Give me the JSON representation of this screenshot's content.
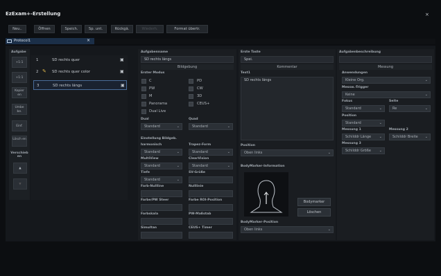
{
  "window": {
    "title": "EzExam+-Erstellung",
    "close": "×"
  },
  "toolbar": [
    "Neu..",
    "Öffnen",
    "Speich.",
    "Sp. unt.",
    "Rückgä.",
    "Wiederh.",
    "Format übertr."
  ],
  "tab": {
    "label": "Protocol1",
    "close": "×"
  },
  "left": {
    "aufgabe": "Aufgabe",
    "btn1": "+1:1",
    "btn2": "+1:1",
    "kopieren": "Kopier en",
    "umbenennen": "Umbe\nbe.",
    "einf": "Einf.",
    "loeschen": "Lösch en",
    "verschieben": "Verschieb en",
    "up": "▲",
    "down": "▼"
  },
  "tasks": [
    {
      "num": "1",
      "label": "SD rechts quer"
    },
    {
      "num": "2",
      "label": "SD rechts quer color"
    },
    {
      "num": "3",
      "label": "SD rechts längs"
    }
  ],
  "aufgabe": {
    "name_label": "Aufgabenname",
    "name_value": "SD rechts längs",
    "bildgebung": "Bildgebung",
    "erster_modus": "Erster Modus",
    "modes_left": [
      "C",
      "PW",
      "M",
      "Panorama",
      "Dual Live"
    ],
    "modes_right": [
      "PD",
      "CW",
      "3D",
      "CEUS+"
    ],
    "dual": "Dual",
    "dual_val": "Standard",
    "quad": "Quad",
    "quad_val": "Standard",
    "einst": "Einstellung Bildgeb.",
    "harmonisch": "harmonisch",
    "harm_val": "Standard",
    "trapez": "Trapez-Form",
    "trapez_val": "Standard",
    "multiview": "MultiView",
    "mv_val": "Standard",
    "clear": "ClearVision",
    "cv_val": "Standard",
    "tiefe": "Tiefe",
    "tiefe_val": "Standard",
    "sv": "SV-Größe",
    "farb_null": "Farb-Nullline",
    "null": "Nulllinie",
    "farbe_pw": "Farbe/PW Steer",
    "farbe_roi": "Farbe ROI-Position",
    "farbskala": "Farbskala",
    "pw_mass": "PW-Maßstab",
    "simultan": "Simultan",
    "ceus_timer": "CEUS+ Timer"
  },
  "mitte": {
    "erste_taste": "Erste Taste",
    "erste_val": "Spei.",
    "kommentar": "Kommentar",
    "text1": "Text1",
    "text_val": "SD rechts längs",
    "position": "Position",
    "pos_val": "Oben links",
    "bodymarker_info": "BodyMarker-Information",
    "bodymarker_btn": "Bodymarker",
    "loeschen_btn": "Löschen",
    "bm_pos": "BodyMarker-Position",
    "bm_pos_val": "Oben links"
  },
  "rechts": {
    "beschr": "Aufgabenbeschreibung",
    "messung": "Messung",
    "anwend": "Anwendungen",
    "anwend_val": "Kleine Org.",
    "trigger": "Messw.-Trigger",
    "trigger_val": "Keine",
    "fokus": "Fokus",
    "fokus_val": "Standard",
    "seite": "Seite",
    "seite_val": "Re",
    "position": "Position",
    "position_val": "Standard",
    "m1": "Messung 1",
    "m1_val": "Schilddr Länge",
    "m2": "Messung 2",
    "m2_val": "Schilddr Breite",
    "m3": "Messung 3",
    "m3_val": "Schilddr Größe"
  }
}
